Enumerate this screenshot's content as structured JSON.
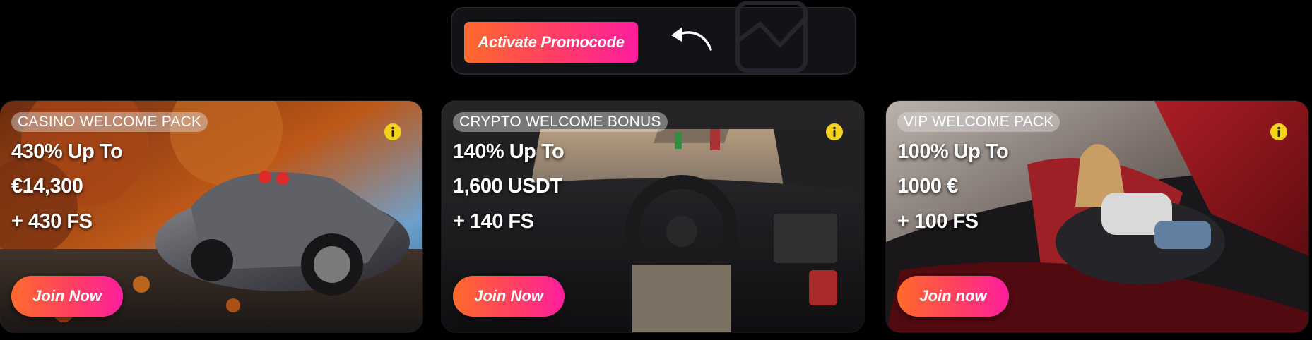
{
  "promo": {
    "button_label": "Activate Promocode",
    "arrow_icon": "curved-arrow-left-icon",
    "image_icon": "image-placeholder-icon"
  },
  "cards": [
    {
      "label": "CASINO WELCOME PACK",
      "line1": "430% Up To",
      "line2": "€14,300",
      "line3": "+ 430 FS",
      "button": "Join Now",
      "info_icon": "info-icon",
      "background": "sports-car-autumn-forest"
    },
    {
      "label": "CRYPTO WELCOME BONUS",
      "line1": "140% Up To",
      "line2": "1,600 USDT",
      "line3": "+ 140 FS",
      "button": "Join Now",
      "info_icon": "info-icon",
      "background": "car-cockpit-driver-view"
    },
    {
      "label": "VIP WELCOME PACK",
      "line1": "100% Up To",
      "line2": "1000 €",
      "line3": "+ 100 FS",
      "button": "Join now",
      "info_icon": "info-icon",
      "background": "woman-in-red-convertible"
    }
  ],
  "colors": {
    "accent_start": "#ff6a2b",
    "accent_end": "#ff1e9e",
    "info_yellow": "#f5d21c",
    "background": "#000000"
  }
}
